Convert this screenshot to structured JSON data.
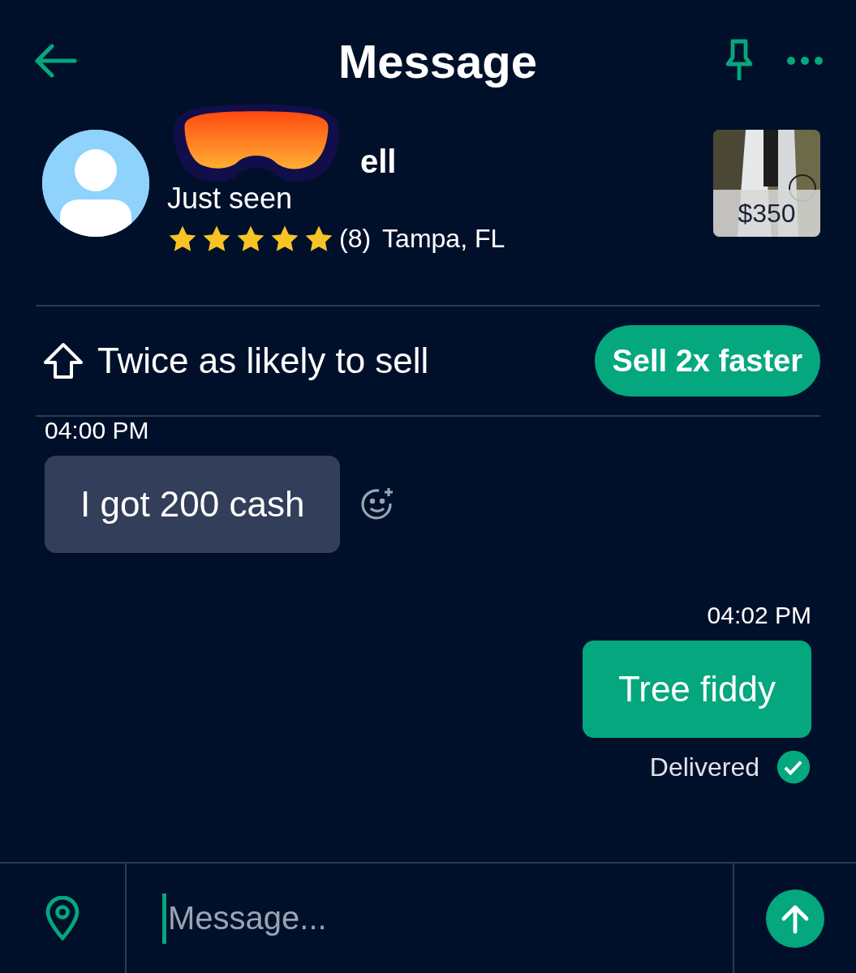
{
  "header": {
    "title": "Message"
  },
  "profile": {
    "name_visible": "ell",
    "status": "Just seen",
    "stars": 5,
    "rating_count": "(8)",
    "location": "Tampa, FL",
    "listing_price": "$350"
  },
  "promo": {
    "text": "Twice as likely to sell",
    "button": "Sell 2x faster"
  },
  "messages": [
    {
      "kind": "incoming",
      "time": "04:00 PM",
      "text": "I got 200 cash"
    },
    {
      "kind": "outgoing",
      "time": "04:02 PM",
      "text": "Tree fiddy",
      "status": "Delivered"
    }
  ],
  "composer": {
    "placeholder": "Message..."
  }
}
